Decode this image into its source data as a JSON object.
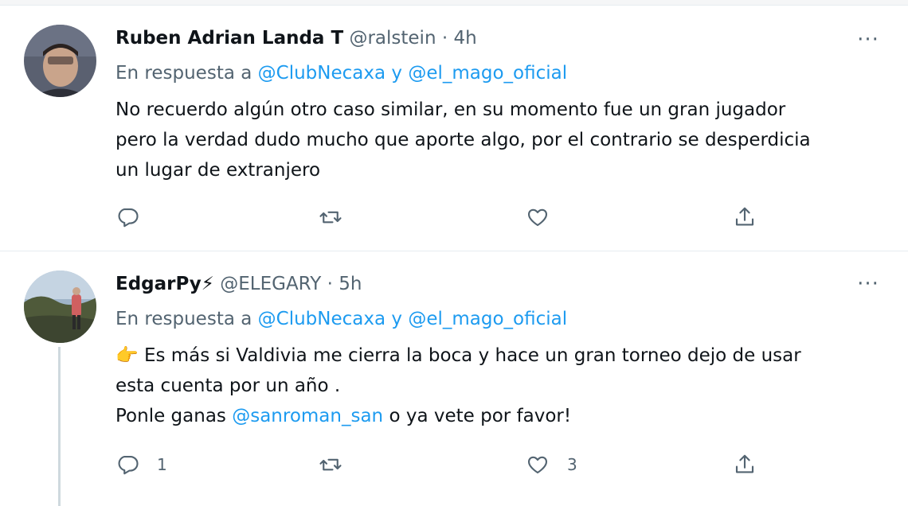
{
  "tweets": [
    {
      "name": "Ruben Adrian Landa T",
      "handle": "@ralstein",
      "separator": "·",
      "time": "4h",
      "reply_prefix": "En respuesta a",
      "reply_mention_1": "@ClubNecaxa",
      "reply_conj": "y",
      "reply_mention_2": "@el_mago_oficial",
      "text_lines": [
        "No recuerdo algún otro caso similar, en su momento fue un gran jugador",
        "pero la verdad dudo mucho que aporte algo, por el contrario se desperdicia",
        "un lugar de extranjero"
      ],
      "reply_count": "",
      "retweet_count": "",
      "like_count": "",
      "more": "···"
    },
    {
      "name": "EdgarPy⚡",
      "handle": "@ELEGARY",
      "separator": "·",
      "time": "5h",
      "reply_prefix": "En respuesta a",
      "reply_mention_1": "@ClubNecaxa",
      "reply_conj": "y",
      "reply_mention_2": "@el_mago_oficial",
      "emoji": "👉",
      "text_line_1": "Es más si Valdivia me cierra la boca y hace un gran torneo dejo de usar",
      "text_line_2": "esta cuenta por un año .",
      "text_line_3_pre": "Ponle ganas",
      "text_line_3_mention": "@sanroman_san",
      "text_line_3_post": "o ya vete por favor!",
      "reply_count": "1",
      "retweet_count": "",
      "like_count": "3",
      "more": "···"
    }
  ],
  "colors": {
    "accent": "#1d9bf0",
    "secondary_text": "#536471",
    "primary_text": "#0f1419",
    "divider": "#e6ecf0"
  },
  "icons": [
    "reply-icon",
    "retweet-icon",
    "like-icon",
    "share-icon",
    "more-icon"
  ]
}
